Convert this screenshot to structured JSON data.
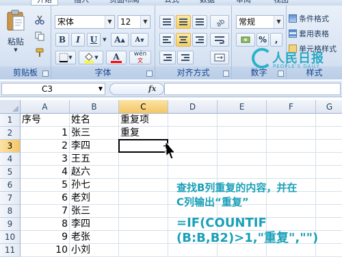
{
  "tabs": [
    {
      "label": "开始",
      "active": true
    },
    {
      "label": "插入"
    },
    {
      "label": "页面布局"
    },
    {
      "label": "公式"
    },
    {
      "label": "数据"
    },
    {
      "label": "审阅"
    },
    {
      "label": "视图"
    }
  ],
  "ribbon": {
    "clipboard": {
      "label": "剪贴板",
      "paste_label": "粘贴"
    },
    "font": {
      "label": "字体",
      "font_name": "宋体",
      "font_size": "12",
      "grow_label": "A",
      "shrink_label": "A",
      "bold_label": "B",
      "italic_label": "I",
      "underline_label": "U",
      "phonetic_label": "wén",
      "fill_color": "#ffff00",
      "font_color": "#ff0000"
    },
    "alignment": {
      "label": "对齐方式"
    },
    "number": {
      "label": "数字",
      "format": "常规",
      "percent_label": "%",
      "comma_label": ","
    },
    "styles": {
      "label": "样式",
      "items": [
        {
          "label": "条件格式"
        },
        {
          "label": "套用表格"
        },
        {
          "label": "单元格样式"
        }
      ]
    }
  },
  "formula_bar": {
    "name_box": "C3",
    "fx_label": "fx",
    "formula": ""
  },
  "columns": [
    "A",
    "B",
    "C",
    "D",
    "E",
    "F",
    "G"
  ],
  "rows": [
    {
      "num": "1",
      "a": "序号",
      "b": "姓名",
      "c": "重复项"
    },
    {
      "num": "2",
      "a": "1",
      "b": "张三",
      "c": "重复"
    },
    {
      "num": "3",
      "a": "2",
      "b": "李四",
      "c": ""
    },
    {
      "num": "4",
      "a": "3",
      "b": "王五",
      "c": ""
    },
    {
      "num": "5",
      "a": "4",
      "b": "赵六",
      "c": ""
    },
    {
      "num": "6",
      "a": "5",
      "b": "孙七",
      "c": ""
    },
    {
      "num": "7",
      "a": "6",
      "b": "老刘",
      "c": ""
    },
    {
      "num": "8",
      "a": "7",
      "b": "张三",
      "c": ""
    },
    {
      "num": "9",
      "a": "8",
      "b": "李四",
      "c": ""
    },
    {
      "num": "10",
      "a": "9",
      "b": "老张",
      "c": ""
    },
    {
      "num": "11",
      "a": "10",
      "b": "小刘",
      "c": ""
    }
  ],
  "active_cell": "C3",
  "watermark": {
    "main": "人民日报",
    "sub": "PEOPLE'S DAILY"
  },
  "annotation": {
    "line1": "查找B列重复的内容，并在",
    "line2": "C列输出“重复”",
    "line3": "=IF(COUNTIF",
    "line4": "(B:B,B2)>1,\"重复\",\"\")"
  },
  "colors": {
    "accent": "#1aa0b8",
    "ribbon_text": "#15428b"
  }
}
